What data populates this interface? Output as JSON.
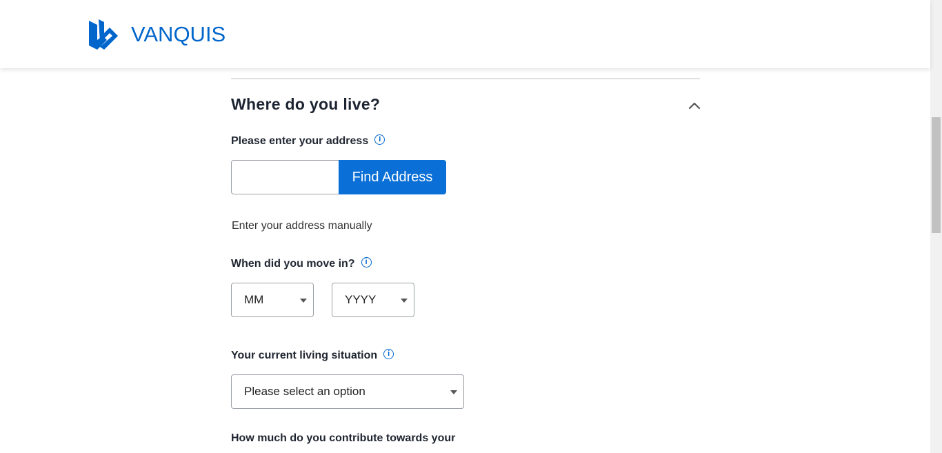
{
  "header": {
    "brand": "VANQUIS",
    "brand_color": "#0066cc"
  },
  "section": {
    "title": "Where do you live?",
    "collapse_icon": "chevron-up-icon"
  },
  "address": {
    "label": "Please enter your address",
    "input_value": "",
    "input_placeholder": "",
    "find_button": "Find Address",
    "manual_link": "Enter your address manually"
  },
  "move_in": {
    "label": "When did you move in?",
    "month_value": "MM",
    "year_value": "YYYY"
  },
  "living": {
    "label": "Your current living situation",
    "select_value": "Please select an option"
  },
  "contribution": {
    "label": "How much do you contribute towards your"
  },
  "colors": {
    "primary": "#0a6fd6",
    "text_dark": "#1c2331"
  }
}
